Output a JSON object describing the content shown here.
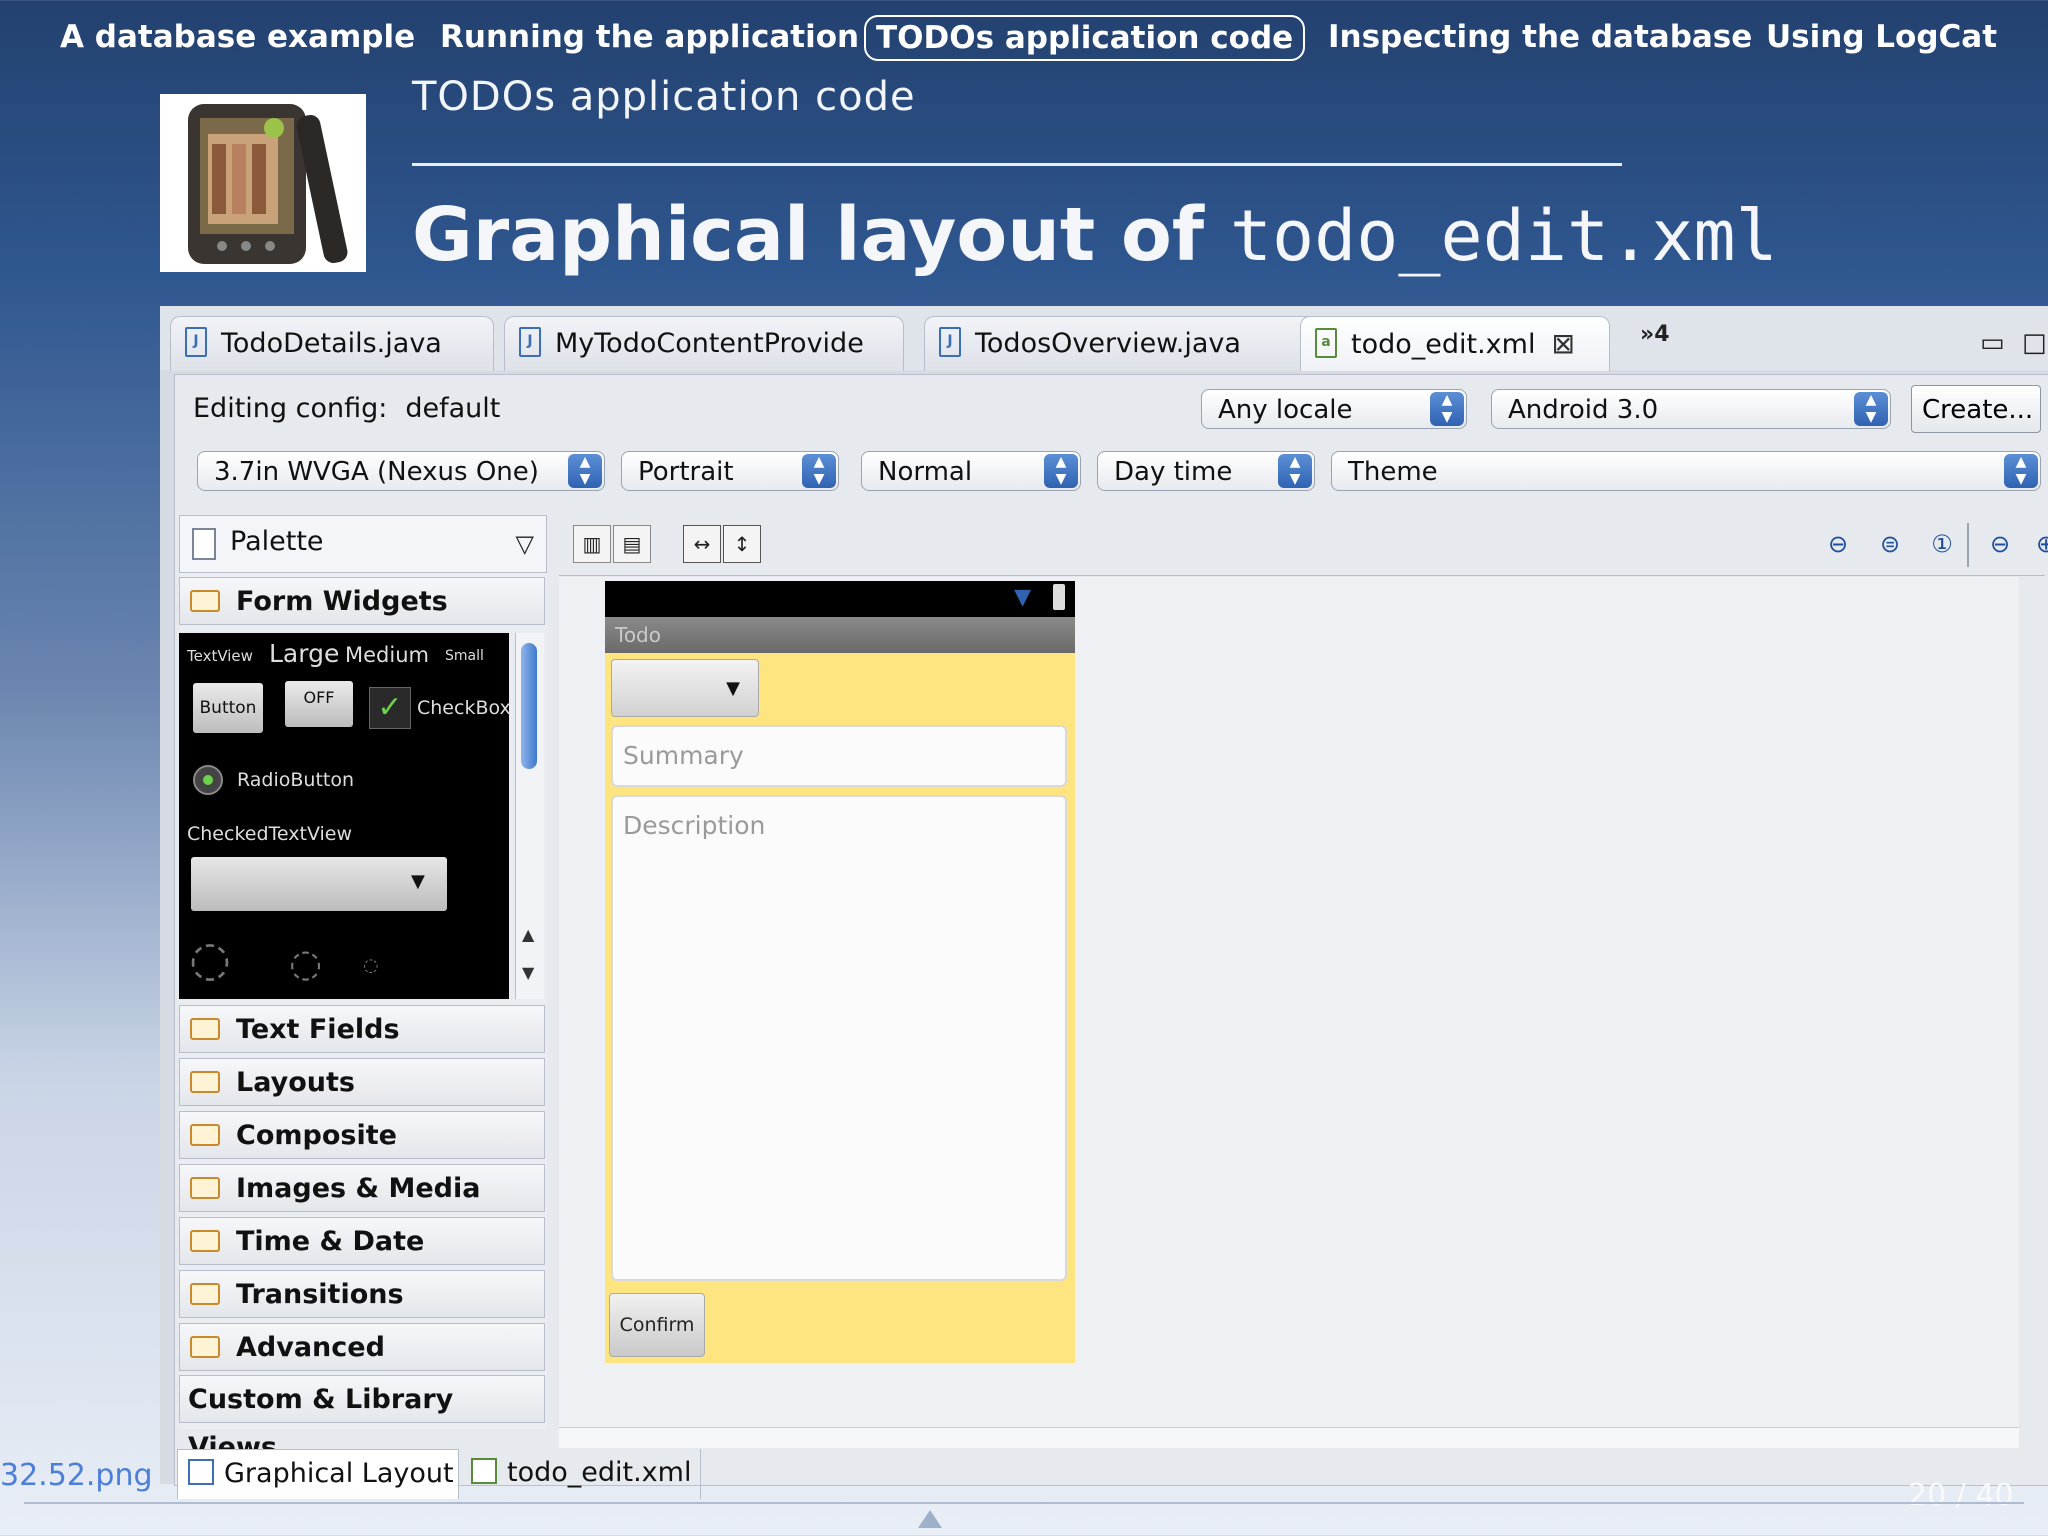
{
  "nav": {
    "items": [
      "A database example",
      "Running the application",
      "TODOs application code",
      "Inspecting the database",
      "Using LogCat"
    ],
    "active_index": 2
  },
  "slide": {
    "section": "TODOs application code",
    "title_prefix": "Graphical layout of ",
    "title_code": "todo_edit.xml"
  },
  "editor_tabs": {
    "items": [
      {
        "label": "TodoDetails.java",
        "icon": "java-file-icon"
      },
      {
        "label": "MyTodoContentProvide",
        "icon": "java-file-icon"
      },
      {
        "label": "TodosOverview.java",
        "icon": "java-file-icon"
      },
      {
        "label": "todo_edit.xml",
        "icon": "xml-file-icon",
        "active": true
      }
    ],
    "overflow_label": "»4"
  },
  "config": {
    "label": "Editing config:",
    "value": "default",
    "locale": "Any locale",
    "target": "Android 3.0",
    "create_label": "Create...",
    "device": "3.7in WVGA (Nexus One)",
    "orientation": "Portrait",
    "mode": "Normal",
    "time": "Day time",
    "theme": "Theme"
  },
  "palette": {
    "title": "Palette",
    "open_category": "Form Widgets",
    "widgets": {
      "textview": "TextView",
      "large": "Large",
      "medium": "Medium",
      "small": "Small",
      "button": "Button",
      "toggle": "OFF",
      "checkbox": "CheckBox",
      "radio": "RadioButton",
      "checked_text": "CheckedTextView"
    },
    "categories": [
      "Text Fields",
      "Layouts",
      "Composite",
      "Images & Media",
      "Time & Date",
      "Transitions",
      "Advanced"
    ],
    "custom": "Custom & Library Views"
  },
  "device_preview": {
    "app_title": "Todo",
    "summary_hint": "Summary",
    "description_hint": "Description",
    "confirm_label": "Confirm"
  },
  "bottom_tabs": {
    "items": [
      "Graphical Layout",
      "todo_edit.xml"
    ],
    "active_index": 0
  },
  "footer": {
    "filename": "32.52.png",
    "page": "20 / 40"
  },
  "colors": {
    "device_background": "#ffe57f",
    "accent": "#3e78cc"
  }
}
